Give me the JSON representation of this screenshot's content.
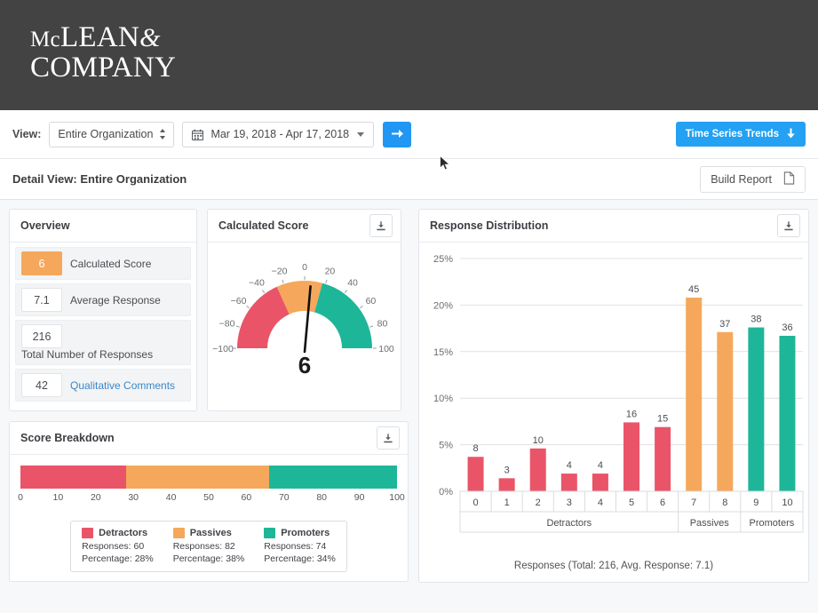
{
  "brand": {
    "line1_small": "Mc",
    "line1_large": "LEAN",
    "amp": "&",
    "line2": "COMPANY"
  },
  "toolbar": {
    "view_label": "View:",
    "org_select_value": "Entire Organization",
    "date_range": "Mar 19, 2018 - Apr 17, 2018",
    "go_button_icon": "arrow-right-icon",
    "time_series_label": "Time Series Trends"
  },
  "detail": {
    "title": "Detail View: Entire Organization",
    "build_report_label": "Build Report"
  },
  "overview": {
    "title": "Overview",
    "rows": [
      {
        "value": "6",
        "label": "Calculated Score",
        "accent": true,
        "link": false
      },
      {
        "value": "7.1",
        "label": "Average Response",
        "accent": false,
        "link": false
      },
      {
        "value": "216",
        "label": "Total Number of Responses",
        "accent": false,
        "link": false
      },
      {
        "value": "42",
        "label": "Qualitative Comments",
        "accent": false,
        "link": true
      }
    ]
  },
  "gauge": {
    "title": "Calculated Score",
    "value": 6,
    "value_text": "6",
    "min": -100,
    "max": 100,
    "ticks": [
      "-100",
      "-80",
      "-60",
      "-40",
      "-20",
      "0",
      "20",
      "40",
      "60",
      "80",
      "100"
    ],
    "bands": [
      {
        "name": "Detractors",
        "from": -100,
        "to": -27,
        "color": "#ea5468"
      },
      {
        "name": "Passives",
        "from": -27,
        "to": 17,
        "color": "#f5a85b"
      },
      {
        "name": "Promoters",
        "from": 17,
        "to": 100,
        "color": "#1eb698"
      }
    ]
  },
  "score_breakdown": {
    "title": "Score Breakdown",
    "axis_ticks": [
      "0",
      "10",
      "20",
      "30",
      "40",
      "50",
      "60",
      "70",
      "80",
      "90",
      "100"
    ],
    "segments": [
      {
        "name": "Detractors",
        "percent": 28,
        "responses": 60,
        "color": "#ea5468"
      },
      {
        "name": "Passives",
        "percent": 38,
        "responses": 82,
        "color": "#f5a85b"
      },
      {
        "name": "Promoters",
        "percent": 34,
        "responses": 74,
        "color": "#1eb698"
      }
    ],
    "legend_response_prefix": "Responses: ",
    "legend_percent_prefix": "Percentage: "
  },
  "response_distribution": {
    "title": "Response Distribution",
    "footer": "Responses (Total: 216, Avg. Response: 7.1)",
    "group_labels": [
      "Detractors",
      "Passives",
      "Promoters"
    ]
  },
  "chart_data": [
    {
      "type": "bar",
      "title": "Response Distribution",
      "categories": [
        "0",
        "1",
        "2",
        "3",
        "4",
        "5",
        "6",
        "7",
        "8",
        "9",
        "10"
      ],
      "values": [
        8,
        3,
        10,
        4,
        4,
        16,
        15,
        45,
        37,
        38,
        36
      ],
      "percentages": [
        3.7,
        1.4,
        4.6,
        1.9,
        1.9,
        7.4,
        6.9,
        20.8,
        17.1,
        17.6,
        16.7
      ],
      "colors": [
        "#ea5468",
        "#ea5468",
        "#ea5468",
        "#ea5468",
        "#ea5468",
        "#ea5468",
        "#ea5468",
        "#f5a85b",
        "#f5a85b",
        "#1eb698",
        "#1eb698"
      ],
      "groups": [
        {
          "label": "Detractors",
          "from": 0,
          "to": 6
        },
        {
          "label": "Passives",
          "from": 7,
          "to": 8
        },
        {
          "label": "Promoters",
          "from": 9,
          "to": 10
        }
      ],
      "xlabel": "Responses (Total: 216, Avg. Response: 7.1)",
      "ylabel": "",
      "ytick_labels": [
        "0%",
        "5%",
        "10%",
        "15%",
        "20%",
        "25%"
      ],
      "ytick_values": [
        0,
        5,
        10,
        15,
        20,
        25
      ],
      "ylim": [
        0,
        25
      ],
      "grid": true,
      "legend": "none"
    },
    {
      "type": "bar",
      "title": "Score Breakdown",
      "orientation": "horizontal-stacked",
      "categories": [
        "Detractors",
        "Passives",
        "Promoters"
      ],
      "values": [
        28,
        38,
        34
      ],
      "counts": [
        60,
        82,
        74
      ],
      "colors": [
        "#ea5468",
        "#f5a85b",
        "#1eb698"
      ],
      "xlim": [
        0,
        100
      ],
      "xtick_labels": [
        "0",
        "10",
        "20",
        "30",
        "40",
        "50",
        "60",
        "70",
        "80",
        "90",
        "100"
      ],
      "legend": "bottom-center"
    },
    {
      "type": "gauge",
      "title": "Calculated Score",
      "value": 6,
      "range": [
        -100,
        100
      ],
      "tick_labels": [
        "-100",
        "-80",
        "-60",
        "-40",
        "-20",
        "0",
        "20",
        "40",
        "60",
        "80",
        "100"
      ],
      "bands": [
        {
          "label": "Detractors",
          "range": [
            -100,
            -27
          ],
          "color": "#ea5468"
        },
        {
          "label": "Passives",
          "range": [
            -27,
            17
          ],
          "color": "#f5a85b"
        },
        {
          "label": "Promoters",
          "range": [
            17,
            100
          ],
          "color": "#1eb698"
        }
      ]
    }
  ],
  "colors": {
    "red": "#ea5468",
    "orange": "#f5a85b",
    "green": "#1eb698",
    "blue": "#24a1f2",
    "header_bg": "#434343"
  }
}
